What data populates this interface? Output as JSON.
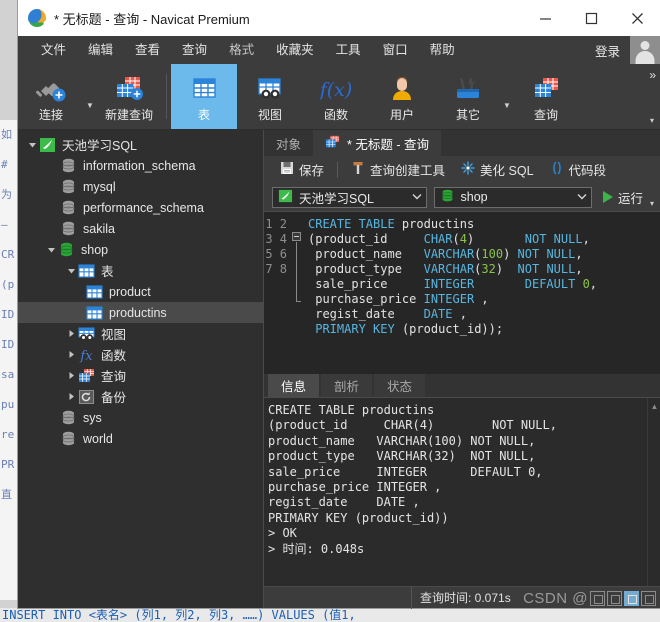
{
  "window": {
    "title": "* 无标题 - 查询 - Navicat Premium",
    "logo_icon": "navicat-logo-icon",
    "minimize_label": "minimize-icon",
    "maximize_label": "maximize-icon",
    "close_label": "close-icon"
  },
  "menubar": {
    "items": [
      {
        "label": "文件"
      },
      {
        "label": "编辑"
      },
      {
        "label": "查看"
      },
      {
        "label": "查询"
      },
      {
        "label": "格式"
      },
      {
        "label": "收藏夹"
      },
      {
        "label": "工具"
      },
      {
        "label": "窗口"
      },
      {
        "label": "帮助"
      }
    ],
    "login_label": "登录",
    "avatar_icon": "user-avatar-icon"
  },
  "ribbon": {
    "overflow_label": "»",
    "more_label": "▾",
    "buttons": [
      {
        "label": "连接",
        "icon": "connection-plug-icon",
        "caret": true,
        "active": false
      },
      {
        "label": "新建查询",
        "icon": "new-query-icon",
        "caret": false,
        "active": false
      },
      {
        "label": "表",
        "icon": "table-icon",
        "caret": false,
        "active": true
      },
      {
        "label": "视图",
        "icon": "view-icon",
        "caret": false,
        "active": false
      },
      {
        "label": "函数",
        "icon": "function-fx-icon",
        "caret": false,
        "active": false
      },
      {
        "label": "用户",
        "icon": "user-icon",
        "caret": false,
        "active": false
      },
      {
        "label": "其它",
        "icon": "other-tools-icon",
        "caret": true,
        "active": false
      },
      {
        "label": "查询",
        "icon": "query-icon",
        "caret": false,
        "active": false
      }
    ]
  },
  "sidebar": {
    "items": [
      {
        "label": "天池学习SQL",
        "icon": "connection-icon",
        "indent": 0,
        "twisty": "open",
        "selected": false
      },
      {
        "label": "information_schema",
        "icon": "database-icon",
        "indent": 1,
        "twisty": "none",
        "selected": false
      },
      {
        "label": "mysql",
        "icon": "database-icon",
        "indent": 1,
        "twisty": "none",
        "selected": false
      },
      {
        "label": "performance_schema",
        "icon": "database-icon",
        "indent": 1,
        "twisty": "none",
        "selected": false
      },
      {
        "label": "sakila",
        "icon": "database-icon",
        "indent": 1,
        "twisty": "none",
        "selected": false
      },
      {
        "label": "shop",
        "icon": "database-open-icon",
        "indent": 1,
        "twisty": "open",
        "selected": false
      },
      {
        "label": "表",
        "icon": "table-folder-icon",
        "indent": 2,
        "twisty": "open",
        "selected": false
      },
      {
        "label": "product",
        "icon": "table-icon",
        "indent": 3,
        "twisty": "none",
        "selected": false
      },
      {
        "label": "productins",
        "icon": "table-icon",
        "indent": 3,
        "twisty": "none",
        "selected": true
      },
      {
        "label": "视图",
        "icon": "view-folder-icon",
        "indent": 2,
        "twisty": "closed",
        "selected": false
      },
      {
        "label": "函数",
        "icon": "function-fx-icon",
        "indent": 2,
        "twisty": "closed",
        "selected": false
      },
      {
        "label": "查询",
        "icon": "query-folder-icon",
        "indent": 2,
        "twisty": "closed",
        "selected": false
      },
      {
        "label": "备份",
        "icon": "backup-icon",
        "indent": 2,
        "twisty": "closed",
        "selected": false
      },
      {
        "label": "sys",
        "icon": "database-icon",
        "indent": 1,
        "twisty": "none",
        "selected": false
      },
      {
        "label": "world",
        "icon": "database-icon",
        "indent": 1,
        "twisty": "none",
        "selected": false
      }
    ]
  },
  "editor_pane": {
    "tabs": [
      {
        "label": "对象",
        "icon": "",
        "active": false
      },
      {
        "label": "* 无标题 - 查询",
        "icon": "query-tab-icon",
        "active": true
      }
    ],
    "toolbar": {
      "save_label": "保存",
      "save_icon": "save-disk-icon",
      "query_builder_label": "查询创建工具",
      "query_builder_icon": "hammer-icon",
      "beautify_label": "美化 SQL",
      "beautify_icon": "magic-wand-icon",
      "snippet_label": "代码段",
      "snippet_icon": "parentheses-icon"
    },
    "connection_combo": {
      "value": "天池学习SQL",
      "icon": "connection-icon",
      "arrow": "chevron-down-icon"
    },
    "database_combo": {
      "value": "shop",
      "icon": "database-open-icon",
      "arrow": "chevron-down-icon"
    },
    "run_button": {
      "label": "运行",
      "icon": "play-triangle-icon",
      "caret": "▾"
    }
  },
  "sql_editor": {
    "line_numbers": [
      "1",
      "2",
      "3",
      "4",
      "5",
      "6",
      "7",
      "8"
    ],
    "lines": [
      [
        {
          "t": "CREATE TABLE ",
          "c": "kw"
        },
        {
          "t": "productins",
          "c": "id"
        }
      ],
      [
        {
          "t": "(product_id     ",
          "c": "id"
        },
        {
          "t": "CHAR",
          "c": "ty"
        },
        {
          "t": "(",
          "c": "id"
        },
        {
          "t": "4",
          "c": "num"
        },
        {
          "t": ")       ",
          "c": "id"
        },
        {
          "t": "NOT NULL",
          "c": "kw"
        },
        {
          "t": ",",
          "c": "id"
        }
      ],
      [
        {
          "t": " product_name   ",
          "c": "id"
        },
        {
          "t": "VARCHAR",
          "c": "ty"
        },
        {
          "t": "(",
          "c": "id"
        },
        {
          "t": "100",
          "c": "num"
        },
        {
          "t": ") ",
          "c": "id"
        },
        {
          "t": "NOT NULL",
          "c": "kw"
        },
        {
          "t": ",",
          "c": "id"
        }
      ],
      [
        {
          "t": " product_type   ",
          "c": "id"
        },
        {
          "t": "VARCHAR",
          "c": "ty"
        },
        {
          "t": "(",
          "c": "id"
        },
        {
          "t": "32",
          "c": "num"
        },
        {
          "t": ")  ",
          "c": "id"
        },
        {
          "t": "NOT NULL",
          "c": "kw"
        },
        {
          "t": ",",
          "c": "id"
        }
      ],
      [
        {
          "t": " sale_price     ",
          "c": "id"
        },
        {
          "t": "INTEGER",
          "c": "ty"
        },
        {
          "t": "       ",
          "c": "id"
        },
        {
          "t": "DEFAULT",
          "c": "kw"
        },
        {
          "t": " ",
          "c": "id"
        },
        {
          "t": "0",
          "c": "num"
        },
        {
          "t": ",",
          "c": "id"
        }
      ],
      [
        {
          "t": " purchase_price ",
          "c": "id"
        },
        {
          "t": "INTEGER",
          "c": "ty"
        },
        {
          "t": " ,",
          "c": "id"
        }
      ],
      [
        {
          "t": " regist_date    ",
          "c": "id"
        },
        {
          "t": "DATE",
          "c": "ty"
        },
        {
          "t": " ,",
          "c": "id"
        }
      ],
      [
        {
          "t": " ",
          "c": "id"
        },
        {
          "t": "PRIMARY KEY",
          "c": "kw"
        },
        {
          "t": " (product_id));",
          "c": "id"
        }
      ]
    ]
  },
  "results": {
    "tabs": [
      {
        "label": "信息",
        "active": true
      },
      {
        "label": "剖析",
        "active": false
      },
      {
        "label": "状态",
        "active": false
      }
    ],
    "message_text": "CREATE TABLE productins\n(product_id     CHAR(4)        NOT NULL,\nproduct_name   VARCHAR(100) NOT NULL,\nproduct_type   VARCHAR(32)  NOT NULL,\nsale_price     INTEGER      DEFAULT 0,\npurchase_price INTEGER ,\nregist_date    DATE ,\nPRIMARY KEY (product_id))\n> OK\n> 时间: 0.048s",
    "scroll_up_icon": "scroll-up-arrow-icon"
  },
  "statusbar": {
    "query_time": "查询时间: 0.071s",
    "watermark_text": "CSDN @"
  },
  "background": {
    "bottom_snippet_prefix": "INSERT INTO <表名> (列1, 列2, 列3, ……) VALUES (值1,",
    "left_strip": "如\n#\n为\n—\nCR\n(p\nID\nID\nsa\npu\nre\nPR\n直"
  },
  "colors": {
    "window_chrome": "#3c3c3c",
    "titlebar": "#ffffff",
    "sidebar_bg": "#2f2f2f",
    "editor_bg": "#262626",
    "accent_active": "#6cb9ec",
    "selection": "#4a4a4a",
    "keyword": "#57b6e0",
    "number": "#8bc34a",
    "run_green": "#3bb54a"
  }
}
